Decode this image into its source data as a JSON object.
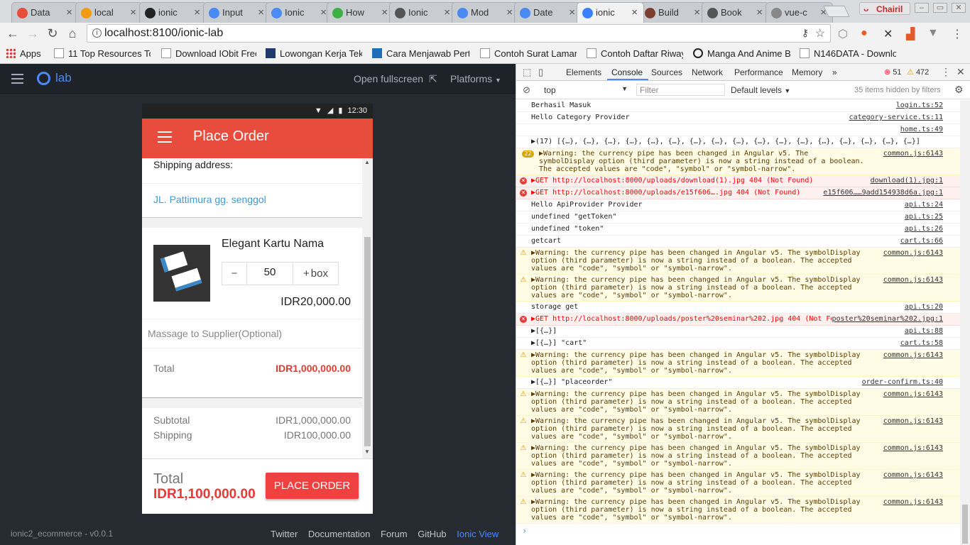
{
  "browser": {
    "tabs": [
      {
        "title": "Data",
        "fav": "#e74c3c"
      },
      {
        "title": "local",
        "fav": "#f39c12"
      },
      {
        "title": "ionic",
        "fav": "#222"
      },
      {
        "title": "Input",
        "fav": "#4a8af4"
      },
      {
        "title": "Ionic",
        "fav": "#4a8af4"
      },
      {
        "title": "How",
        "fav": "#3cb043"
      },
      {
        "title": "Ionic",
        "fav": "#555"
      },
      {
        "title": "Mod",
        "fav": "#4a8af4"
      },
      {
        "title": "Date",
        "fav": "#4a8af4"
      },
      {
        "title": "ionic",
        "fav": "#3880ff"
      },
      {
        "title": "Build",
        "fav": "#7b3f2f"
      },
      {
        "title": "Book",
        "fav": "#555"
      },
      {
        "title": "vue-c",
        "fav": "#888"
      }
    ],
    "user_name": "Chairil",
    "url": "localhost:8100/ionic-lab",
    "bookmarks": [
      "Apps",
      "11 Top Resources To",
      "Download IObit Free",
      "Lowongan Kerja Tek",
      "Cara Menjawab Pert",
      "Contoh Surat Lamar",
      "Contoh Daftar Riway",
      "Manga And Anime B",
      "N146DATA - Downlo"
    ]
  },
  "lab": {
    "logo": "lab",
    "open_fullscreen": "Open fullscreen",
    "platforms": "Platforms",
    "version": "ionic2_ecommerce - v0.0.1",
    "footer_links": [
      "Twitter",
      "Documentation",
      "Forum",
      "GitHub",
      "Ionic View"
    ]
  },
  "app": {
    "time": "12:30",
    "title": "Place Order",
    "shipping_label": "Shipping address:",
    "shipping_address": "JL. Pattimura gg. senggol",
    "product_name": "Elegant Kartu Nama",
    "qty_minus": "−",
    "quantity": "50",
    "qty_plus": "+",
    "unit": "box",
    "unit_price": "IDR20,000.00",
    "message_placeholder": "Massage to Supplier(Optional)",
    "total_label": "Total",
    "total_value": "IDR1,000,000.00",
    "subtotal_label": "Subtotal",
    "subtotal_value": "IDR1,000,000.00",
    "shipping_cost_label": "Shipping",
    "shipping_cost_value": "IDR100,000.00",
    "grand_total_label": "Total",
    "grand_total_value": "IDR1,100,000.00",
    "place_order": "PLACE ORDER"
  },
  "devtools": {
    "tabs": [
      "Elements",
      "Console",
      "Sources",
      "Network",
      "Performance",
      "Memory"
    ],
    "active_tab": "Console",
    "error_count": "51",
    "warning_count": "472",
    "context": "top",
    "filter_placeholder": "Filter",
    "levels": "Default levels",
    "hidden": "35 items hidden by filters",
    "warn_text": "▶Warning: the currency pipe has been changed in Angular v5. The symbolDisplay option (third parameter) is now a string instead of a boolean. The accepted values are \"code\", \"symbol\" or \"symbol-narrow\".",
    "lines": [
      {
        "type": "log",
        "text": "Berhasil Masuk",
        "src": "login.ts:52"
      },
      {
        "type": "log",
        "text": "Hello Category Provider",
        "src": "category-service.ts:11"
      },
      {
        "type": "log",
        "text": "",
        "src": "home.ts:49"
      },
      {
        "type": "log",
        "text": "▶(17) [{…}, {…}, {…}, {…}, {…}, {…}, {…}, {…}, {…}, {…}, {…}, {…}, {…}, {…}, {…}, {…}, {…}]",
        "src": ""
      },
      {
        "type": "warn",
        "badge": "22",
        "text": "▶Warning: the currency pipe has been changed in Angular v5. The symbolDisplay option (third parameter) is now a string instead of a boolean. The accepted values are \"code\", \"symbol\" or \"symbol-narrow\".",
        "src": "common.js:6143"
      },
      {
        "type": "err",
        "text": "▶GET http://localhost:8000/uploads/download(1).jpg 404 (Not Found)",
        "src": "download(1).jpg:1"
      },
      {
        "type": "err",
        "text": "▶GET http://localhost:8000/uploads/e15f606….jpg 404 (Not Found)",
        "src": "e15f606……9add154938d6a.jpg:1"
      },
      {
        "type": "log",
        "text": "Hello ApiProvider Provider",
        "src": "api.ts:24"
      },
      {
        "type": "log",
        "text": "undefined \"getToken\"",
        "src": "api.ts:25"
      },
      {
        "type": "log",
        "text": "undefined \"token\"",
        "src": "api.ts:26"
      },
      {
        "type": "log",
        "text": "getcart",
        "src": "cart.ts:66"
      },
      {
        "type": "warn",
        "text": "▶Warning: the currency pipe has been changed in Angular v5. The symbolDisplay option (third parameter) is now a string instead of a boolean. The accepted values are \"code\", \"symbol\" or \"symbol-narrow\".",
        "src": "common.js:6143"
      },
      {
        "type": "warn",
        "text": "▶Warning: the currency pipe has been changed in Angular v5. The symbolDisplay option (third parameter) is now a string instead of a boolean. The accepted values are \"code\", \"symbol\" or \"symbol-narrow\".",
        "src": "common.js:6143"
      },
      {
        "type": "log",
        "text": "storage get",
        "src": "api.ts:20"
      },
      {
        "type": "err",
        "text": "▶GET http://localhost:8000/uploads/poster%20seminar%202.jpg 404 (Not Found)",
        "src": "poster%20seminar%202.jpg:1"
      },
      {
        "type": "log",
        "text": "▶[{…}]",
        "src": "api.ts:88"
      },
      {
        "type": "log",
        "text": "▶[{…}] \"cart\"",
        "src": "cart.ts:58"
      },
      {
        "type": "warn",
        "text": "▶Warning: the currency pipe has been changed in Angular v5. The symbolDisplay option (third parameter) is now a string instead of a boolean. The accepted values are \"code\", \"symbol\" or \"symbol-narrow\".",
        "src": "common.js:6143"
      },
      {
        "type": "log",
        "text": "▶[{…}] \"placeorder\"",
        "src": "order-confirm.ts:40"
      },
      {
        "type": "warn",
        "text": "▶Warning: the currency pipe has been changed in Angular v5. The symbolDisplay option (third parameter) is now a string instead of a boolean. The accepted values are \"code\", \"symbol\" or \"symbol-narrow\".",
        "src": "common.js:6143"
      },
      {
        "type": "warn",
        "text": "▶Warning: the currency pipe has been changed in Angular v5. The symbolDisplay option (third parameter) is now a string instead of a boolean. The accepted values are \"code\", \"symbol\" or \"symbol-narrow\".",
        "src": "common.js:6143"
      },
      {
        "type": "warn",
        "text": "▶Warning: the currency pipe has been changed in Angular v5. The symbolDisplay option (third parameter) is now a string instead of a boolean. The accepted values are \"code\", \"symbol\" or \"symbol-narrow\".",
        "src": "common.js:6143"
      },
      {
        "type": "warn",
        "text": "▶Warning: the currency pipe has been changed in Angular v5. The symbolDisplay option (third parameter) is now a string instead of a boolean. The accepted values are \"code\", \"symbol\" or \"symbol-narrow\".",
        "src": "common.js:6143"
      },
      {
        "type": "warn",
        "text": "▶Warning: the currency pipe has been changed in Angular v5. The symbolDisplay option (third parameter) is now a string instead of a boolean. The accepted values are \"code\", \"symbol\" or \"symbol-narrow\".",
        "src": "common.js:6143"
      }
    ],
    "prompt": "›"
  },
  "colors": {
    "accent": "#e74c3c",
    "ionic": "#3880ff",
    "price": "#e53935"
  }
}
